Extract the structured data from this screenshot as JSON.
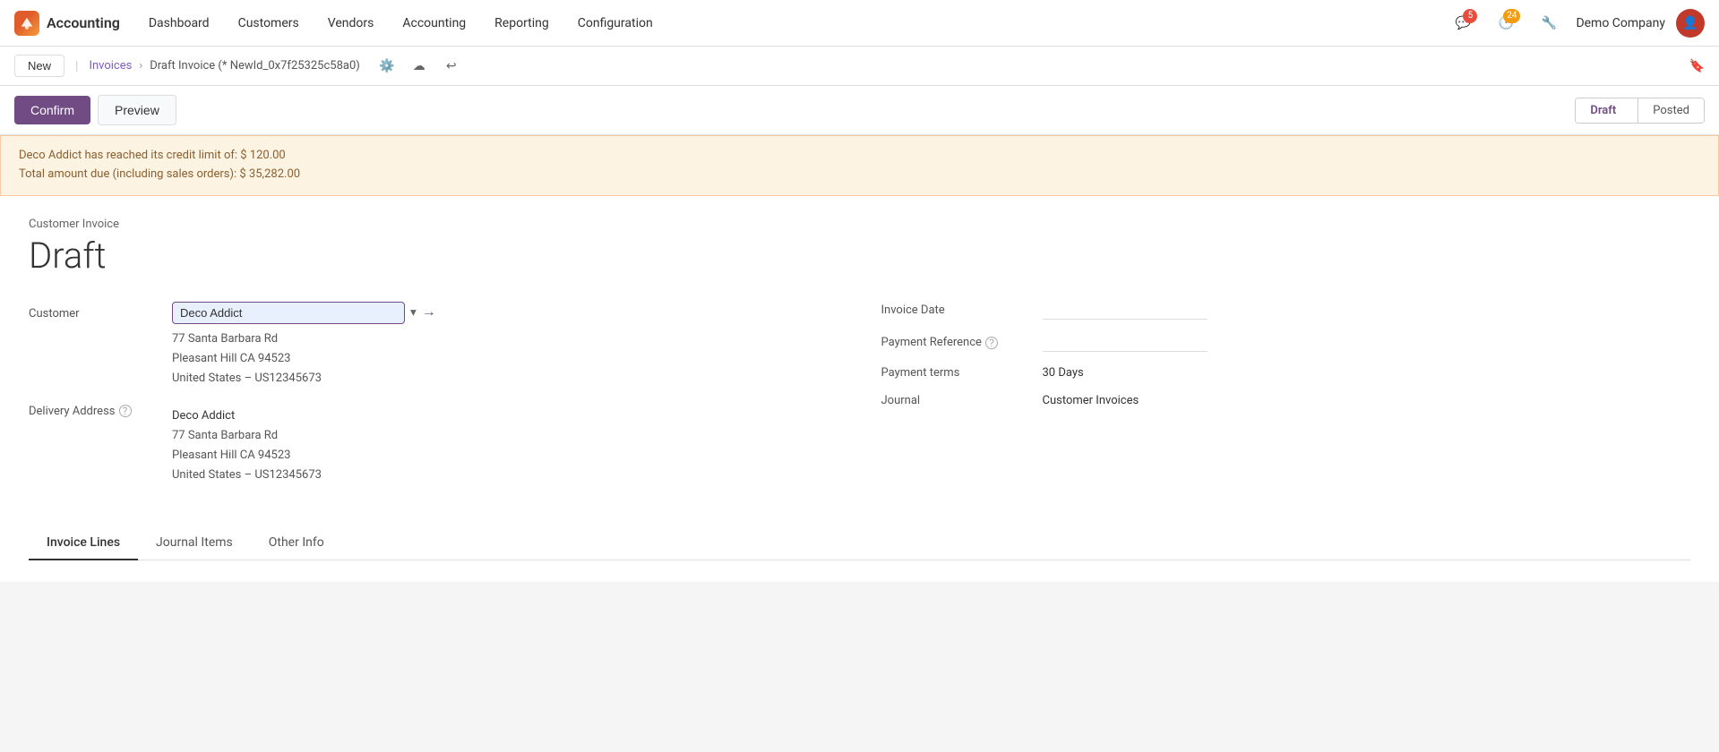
{
  "app": {
    "logo_label": "Accounting",
    "menu_items": [
      "Dashboard",
      "Customers",
      "Vendors",
      "Accounting",
      "Reporting",
      "Configuration"
    ],
    "notifications_chat": "5",
    "notifications_clock": "24",
    "company_name": "Demo Company",
    "avatar_text": "👤"
  },
  "breadcrumb": {
    "parent": "Invoices",
    "current": "Draft Invoice (* NewId_0x7f25325c58a0)",
    "new_button": "New"
  },
  "actions": {
    "confirm_label": "Confirm",
    "preview_label": "Preview",
    "status_draft": "Draft",
    "status_posted": "Posted"
  },
  "warning": {
    "line1": "Deco Addict has reached its credit limit of: $ 120.00",
    "line2": "Total amount due (including sales orders): $ 35,282.00"
  },
  "invoice": {
    "type_label": "Customer Invoice",
    "title": "Draft"
  },
  "form": {
    "customer_label": "Customer",
    "customer_value": "Deco Addict",
    "address_line1": "77 Santa Barbara Rd",
    "address_line2": "Pleasant Hill CA 94523",
    "address_line3": "United States – US12345673",
    "delivery_label": "Delivery Address",
    "delivery_name": "Deco Addict",
    "delivery_line1": "77 Santa Barbara Rd",
    "delivery_line2": "Pleasant Hill CA 94523",
    "delivery_line3": "United States – US12345673",
    "invoice_date_label": "Invoice Date",
    "payment_ref_label": "Payment Reference",
    "payment_terms_label": "Payment terms",
    "payment_terms_value": "30 Days",
    "journal_label": "Journal",
    "journal_value": "Customer Invoices"
  },
  "tabs": [
    {
      "label": "Invoice Lines",
      "active": true
    },
    {
      "label": "Journal Items",
      "active": false
    },
    {
      "label": "Other Info",
      "active": false
    }
  ]
}
